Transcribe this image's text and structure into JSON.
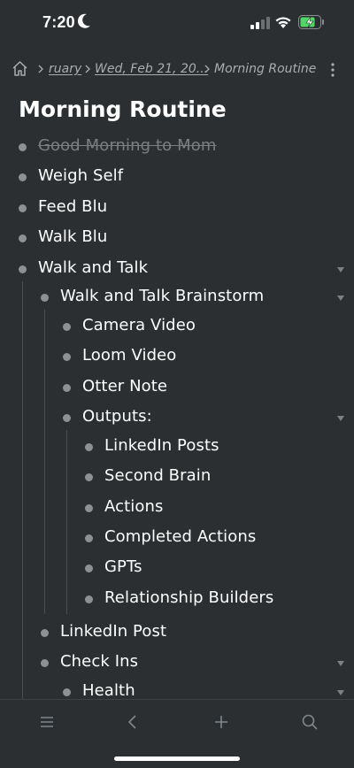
{
  "status_bar": {
    "time": "7:20"
  },
  "breadcrumb": {
    "items": [
      "ruary",
      "Wed, Feb 21, 20...",
      "Morning Routine"
    ]
  },
  "page": {
    "title": "Morning Routine"
  },
  "outline": [
    {
      "text": "Good Morning to Mom",
      "level": 0,
      "completed": true,
      "expanded": false
    },
    {
      "text": "Weigh Self",
      "level": 0,
      "completed": false,
      "expanded": false
    },
    {
      "text": "Feed Blu",
      "level": 0,
      "completed": false,
      "expanded": false
    },
    {
      "text": "Walk Blu",
      "level": 0,
      "completed": false,
      "expanded": false
    },
    {
      "text": "Walk and Talk",
      "level": 0,
      "completed": false,
      "expanded": true
    },
    {
      "text": "Walk and Talk Brainstorm",
      "level": 1,
      "completed": false,
      "expanded": true
    },
    {
      "text": "Camera Video",
      "level": 2,
      "completed": false,
      "expanded": false
    },
    {
      "text": "Loom Video",
      "level": 2,
      "completed": false,
      "expanded": false
    },
    {
      "text": "Otter Note",
      "level": 2,
      "completed": false,
      "expanded": false
    },
    {
      "text": "Outputs:",
      "level": 2,
      "completed": false,
      "expanded": true
    },
    {
      "text": "LinkedIn Posts",
      "level": 3,
      "completed": false,
      "expanded": false
    },
    {
      "text": "Second Brain",
      "level": 3,
      "completed": false,
      "expanded": false
    },
    {
      "text": "Actions",
      "level": 3,
      "completed": false,
      "expanded": false
    },
    {
      "text": "Completed Actions",
      "level": 3,
      "completed": false,
      "expanded": false
    },
    {
      "text": "GPTs",
      "level": 3,
      "completed": false,
      "expanded": false
    },
    {
      "text": "Relationship Builders",
      "level": 3,
      "completed": false,
      "expanded": false
    },
    {
      "text": "LinkedIn Post",
      "level": 1,
      "completed": false,
      "expanded": false
    },
    {
      "text": "Check Ins",
      "level": 1,
      "completed": false,
      "expanded": true
    },
    {
      "text": "Health",
      "level": 2,
      "completed": false,
      "expanded": true
    }
  ],
  "toolbar": {
    "icons": [
      "menu-icon",
      "back-icon",
      "add-icon",
      "search-icon"
    ]
  },
  "colors": {
    "background": "#2b2f31",
    "text": "#ffffff",
    "muted": "#8d9194",
    "battery_charging": "#4cd964"
  }
}
